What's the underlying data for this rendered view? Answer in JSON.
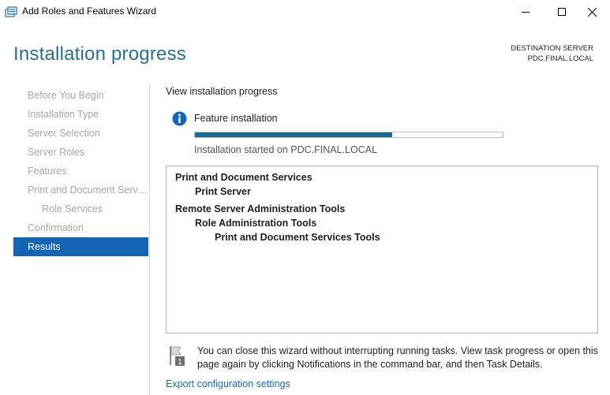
{
  "window": {
    "title": "Add Roles and Features Wizard"
  },
  "header": {
    "page_title": "Installation progress",
    "destination_label": "DESTINATION SERVER",
    "destination_server": "PDC.FINAL.LOCAL"
  },
  "sidebar": {
    "items": [
      {
        "label": "Before You Begin"
      },
      {
        "label": "Installation Type"
      },
      {
        "label": "Server Selection"
      },
      {
        "label": "Server Roles"
      },
      {
        "label": "Features"
      },
      {
        "label": "Print and Document Services"
      },
      {
        "label": "Role Services"
      },
      {
        "label": "Confirmation"
      },
      {
        "label": "Results"
      }
    ]
  },
  "main": {
    "heading": "View installation progress",
    "feature_label": "Feature installation",
    "progress": 0.64,
    "status": "Installation started on PDC.FINAL.LOCAL",
    "results": [
      "Print and Document Services",
      "Print Server",
      "Remote Server Administration Tools",
      "Role Administration Tools",
      "Print and Document Services Tools"
    ],
    "note": "You can close this wizard without interrupting running tasks. View task progress or open this page again by clicking Notifications in the command bar, and then Task Details.",
    "export_link": "Export configuration settings",
    "flag_badge": "1"
  },
  "colors": {
    "accent": "#1565b5",
    "title": "#2a6f8f",
    "progress": "#1b6c8c",
    "link": "#1e67b4"
  },
  "icons": {
    "app": "wizard-icon",
    "info": "info-icon",
    "flag": "flag-icon"
  }
}
